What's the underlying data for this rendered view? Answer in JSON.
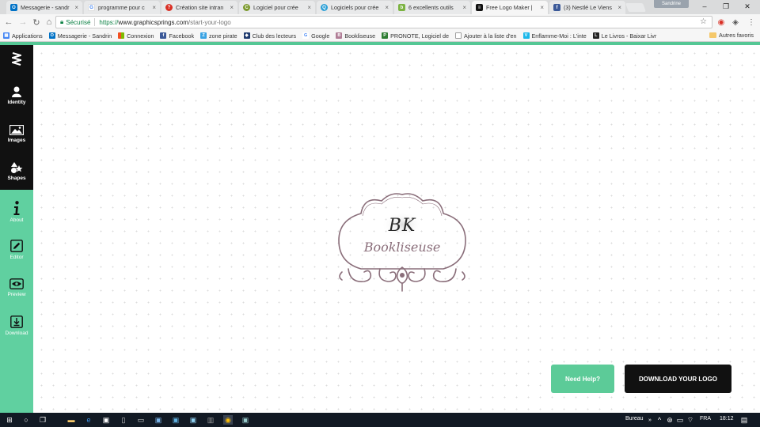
{
  "browser": {
    "tabs": [
      {
        "title": "Messagerie - sandr",
        "favicon": "outlook-icon",
        "color": "#0072c6",
        "active": false
      },
      {
        "title": "programme pour c",
        "favicon": "google-icon",
        "color": "#4285f4",
        "active": false
      },
      {
        "title": "Création site intran",
        "favicon": "help-icon",
        "color": "#d93025",
        "active": false
      },
      {
        "title": "Logiciel pour crée",
        "favicon": "site-icon",
        "color": "#7c9a2e",
        "active": false
      },
      {
        "title": "Logiciels pour crée",
        "favicon": "site-icon",
        "color": "#2a9fd6",
        "active": false
      },
      {
        "title": "6 excellents outils",
        "favicon": "site-icon",
        "color": "#7cb342",
        "active": false
      },
      {
        "title": "Free Logo Maker |",
        "favicon": "graphicsprings-icon",
        "color": "#111111",
        "active": true
      },
      {
        "title": "(3) Nestlé Le Viens",
        "favicon": "facebook-icon",
        "color": "#3b5998",
        "active": false
      }
    ],
    "profile_name": "Sandrine",
    "secure_label": "Sécurisé",
    "url_scheme": "https://",
    "url_host": "www.graphicsprings.com",
    "url_path": "/start-your-logo",
    "bookmarks": [
      {
        "label": "Applications",
        "icon": "apps-icon",
        "color": "#4285f4"
      },
      {
        "label": "Messagerie - Sandrin",
        "icon": "outlook-icon",
        "color": "#0072c6"
      },
      {
        "label": "Connexion",
        "icon": "windows-icon",
        "color": "#f25022"
      },
      {
        "label": "Facebook",
        "icon": "facebook-icon",
        "color": "#3b5998"
      },
      {
        "label": "zone pirate",
        "icon": "zp-icon",
        "color": "#3aa3e3"
      },
      {
        "label": "Club des lecteurs",
        "icon": "book-icon",
        "color": "#1e3a6e"
      },
      {
        "label": "Google",
        "icon": "google-icon",
        "color": "#4285f4"
      },
      {
        "label": "Bookliseuse",
        "icon": "blog-icon",
        "color": "#b07d96"
      },
      {
        "label": "PRONOTE, Logiciel de",
        "icon": "pronote-icon",
        "color": "#2e7d32"
      },
      {
        "label": "Ajouter à la liste d'en",
        "icon": "page-icon",
        "color": "#9e9e9e"
      },
      {
        "label": "Enflamme-Moi : L'inte",
        "icon": "vimeo-icon",
        "color": "#1ab7ea"
      },
      {
        "label": "Le Livros - Baixar Livr",
        "icon": "book-icon",
        "color": "#222222"
      }
    ],
    "other_bookmarks": "Autres favoris"
  },
  "sidebar": {
    "items": [
      {
        "label": "Identity",
        "icon": "person-icon"
      },
      {
        "label": "Images",
        "icon": "image-icon"
      },
      {
        "label": "Shapes",
        "icon": "shapes-icon"
      },
      {
        "label": "About",
        "icon": "info-icon"
      },
      {
        "label": "Editor",
        "icon": "edit-icon"
      },
      {
        "label": "Preview",
        "icon": "eye-icon"
      },
      {
        "label": "Download",
        "icon": "download-icon"
      }
    ]
  },
  "logo": {
    "monogram": "BK",
    "name": "Bookliseuse",
    "color": "#8a6e7a"
  },
  "actions": {
    "help_label": "Need Help?",
    "download_label": "DOWNLOAD YOUR LOGO",
    "help_color": "#5ccb98",
    "download_color": "#111111"
  },
  "taskbar": {
    "desktop_label": "Bureau",
    "language": "FRA",
    "time": "18:12"
  }
}
